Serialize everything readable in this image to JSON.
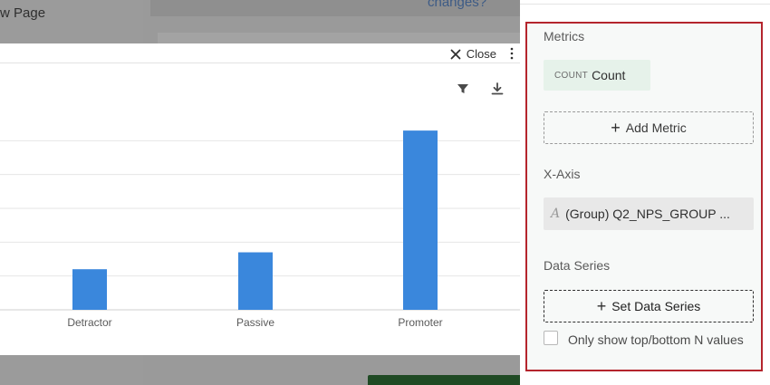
{
  "background": {
    "page_title": "w Page",
    "link_text": "changes?"
  },
  "modal": {
    "close_label": "Close",
    "icons": [
      "close-icon",
      "kebab-icon",
      "filter-icon",
      "download-icon"
    ]
  },
  "chart_data": {
    "type": "bar",
    "categories": [
      "Detractor",
      "Passive",
      "Promoter"
    ],
    "values": [
      12,
      17,
      53
    ],
    "color": "#3a87dc",
    "grid": true,
    "ylim": [
      0,
      60
    ]
  },
  "panel": {
    "metrics_label": "Metrics",
    "metric_type": "COUNT",
    "metric_name": "Count",
    "add_metric_label": "Add Metric",
    "xaxis_label": "X-Axis",
    "xaxis_field": "(Group) Q2_NPS_GROUP ...",
    "data_series_label": "Data Series",
    "set_data_series_label": "Set Data Series",
    "only_show_label": "Only show top/bottom N values",
    "only_show_checked": false
  },
  "colors": {
    "highlight": "#b4252d",
    "bar": "#3a87dc",
    "metric_chip": "#e6f2ea"
  }
}
